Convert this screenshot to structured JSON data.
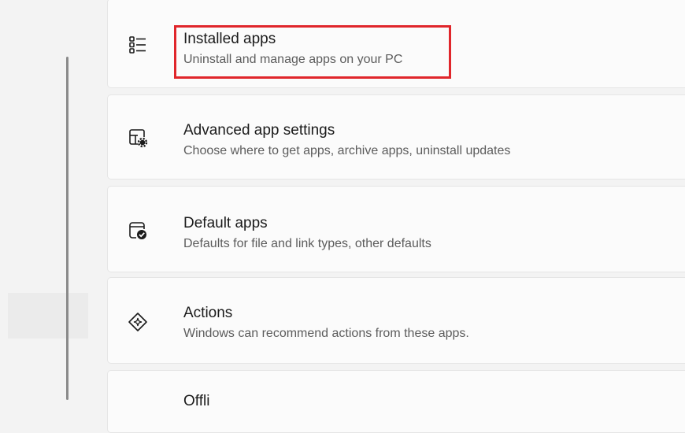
{
  "cards": [
    {
      "title": "Installed apps",
      "subtitle": "Uninstall and manage apps on your PC",
      "icon": "installed-apps-list-icon"
    },
    {
      "title": "Advanced app settings",
      "subtitle": "Choose where to get apps, archive apps, uninstall updates",
      "icon": "app-settings-gear-icon"
    },
    {
      "title": "Default apps",
      "subtitle": "Defaults for file and link types, other defaults",
      "icon": "default-apps-check-icon"
    },
    {
      "title": "Actions",
      "subtitle": "Windows can recommend actions from these apps.",
      "icon": "actions-diamond-sparkle-icon"
    },
    {
      "title": "Offli",
      "subtitle": "",
      "icon": "offline-maps-icon"
    }
  ],
  "colors": {
    "highlight": "#e0262b",
    "card_bg": "#fbfbfb",
    "page_bg": "#f3f3f3"
  }
}
